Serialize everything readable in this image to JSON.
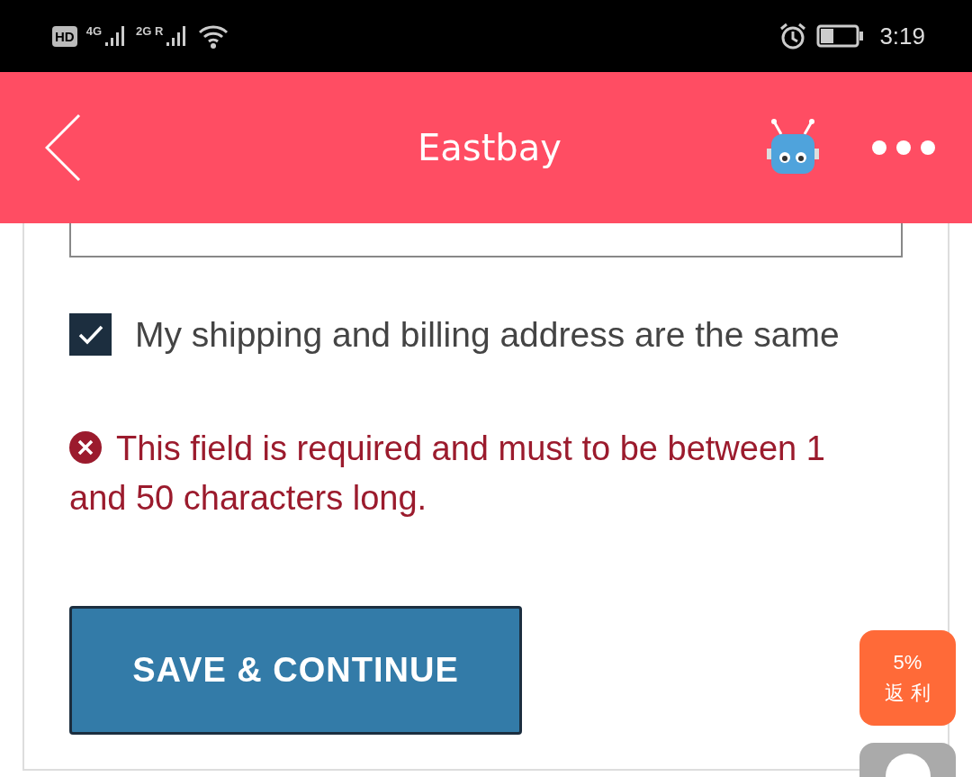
{
  "status_bar": {
    "hd_badge": "HD",
    "network_1": "4G",
    "network_2": "2G R",
    "time": "3:19"
  },
  "header": {
    "title": "Eastbay"
  },
  "same_address": {
    "label": "My shipping and billing address are the same",
    "checked": true
  },
  "error": {
    "message": "This field is required and must to be between 1 and 50 characters long."
  },
  "save_button": {
    "label": "SAVE & CONTINUE"
  },
  "rebate_badge": {
    "percent": "5%",
    "label": "返 利"
  }
}
